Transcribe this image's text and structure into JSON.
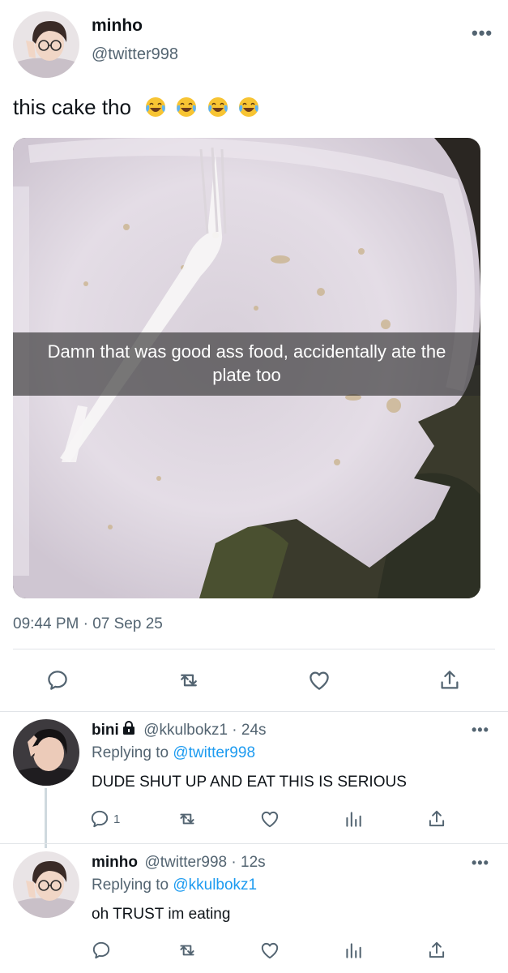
{
  "tweet": {
    "name": "minho",
    "handle": "@twitter998",
    "more": "•••",
    "text": "this cake tho",
    "emoji_names": [
      "face-with-tears-of-joy-icon",
      "face-with-tears-of-joy-icon",
      "face-with-tears-of-joy-icon",
      "face-with-tears-of-joy-icon"
    ],
    "image_caption": "Damn that was good ass food, accidentally ate the plate too",
    "timestamp": "09:44 PM · 07 Sep 25",
    "actions": [
      "reply-icon",
      "retweet-icon",
      "like-icon",
      "share-icon"
    ]
  },
  "replies": [
    {
      "name": "bini",
      "handle": "@kkulbokz1 · 24s",
      "replying_prefix": "Replying to ",
      "replying_to": "@twitter998",
      "text": "DUDE SHUT UP AND EAT THIS IS SERIOUS",
      "reply_count": "1",
      "more": "•••",
      "locked": true
    },
    {
      "name": "minho",
      "handle": "@twitter998 · 12s",
      "replying_prefix": "Replying to ",
      "replying_to": "@kkulbokz1",
      "text": "oh TRUST im eating",
      "more": "•••",
      "locked": false
    }
  ],
  "colors": {
    "link": "#1d9bf0",
    "secondary": "#536471",
    "icon": "#536471",
    "divider": "#e1e4e8"
  }
}
